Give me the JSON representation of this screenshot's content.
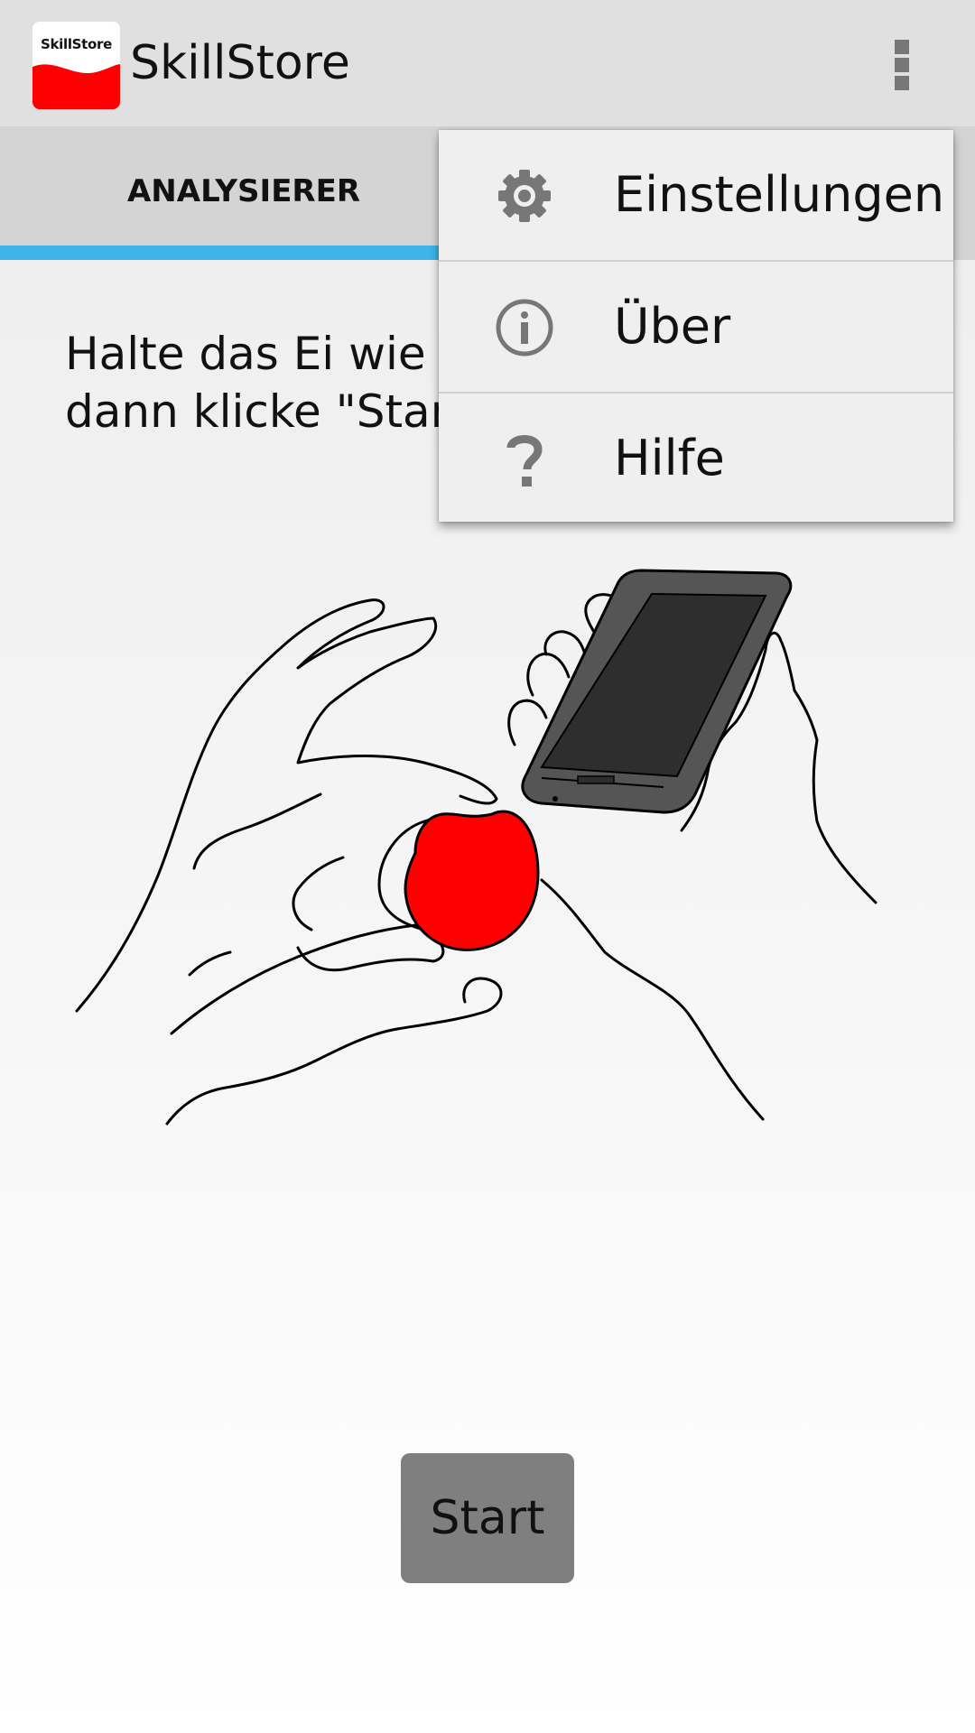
{
  "app": {
    "logo_text": "SkillStore",
    "title": "SkillStore"
  },
  "action_bar": {
    "overflow_icon": "more-vert-icon"
  },
  "tabs": [
    {
      "label": "ANALYSIERER",
      "selected": true
    }
  ],
  "instruction": {
    "line1": "Halte das Ei wie a",
    "line2": "dann klicke \"Start"
  },
  "illustration": {
    "description_icons": [
      "hands-icon",
      "egg-icon",
      "phone-icon"
    ]
  },
  "start_button": {
    "label": "Start"
  },
  "overflow_menu": {
    "items": [
      {
        "label": "Einstellungen",
        "icon": "gear-icon"
      },
      {
        "label": "Über",
        "icon": "info-icon"
      },
      {
        "label": "Hilfe",
        "icon": "help-icon"
      }
    ]
  },
  "colors": {
    "accent": "#3db5e6",
    "egg": "#ff0000",
    "brand_red": "#ff0000",
    "button": "#7f7f7f"
  }
}
